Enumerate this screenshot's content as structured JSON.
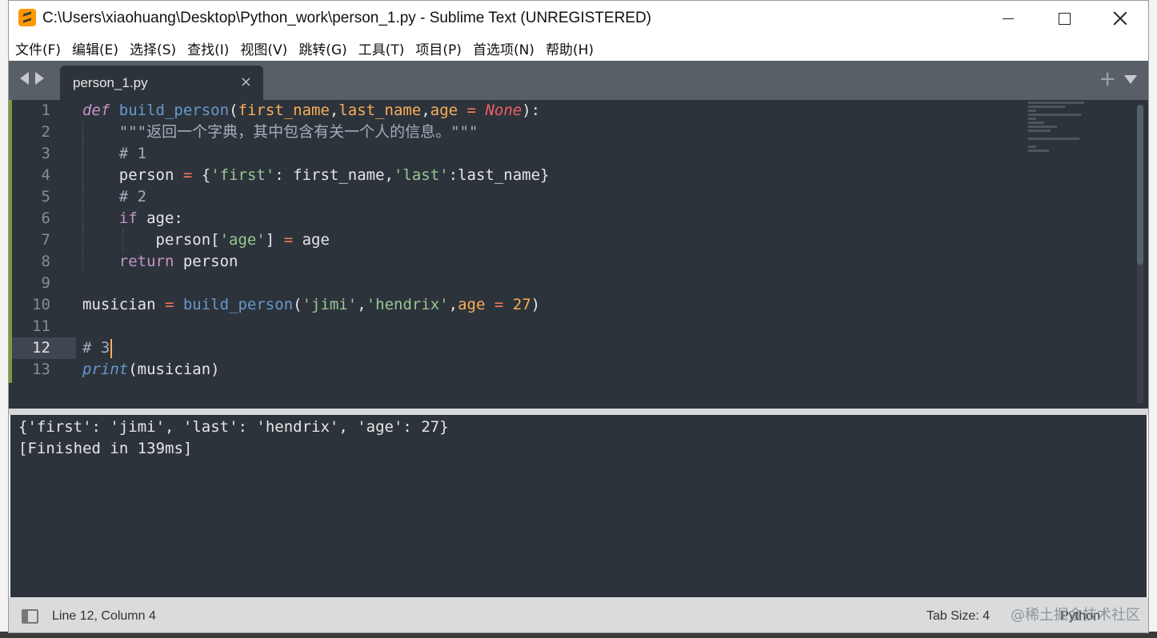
{
  "window": {
    "title": "C:\\Users\\xiaohuang\\Desktop\\Python_work\\person_1.py - Sublime Text (UNREGISTERED)"
  },
  "menu": [
    "文件(F)",
    "编辑(E)",
    "选择(S)",
    "查找(I)",
    "视图(V)",
    "跳转(G)",
    "工具(T)",
    "项目(P)",
    "首选项(N)",
    "帮助(H)"
  ],
  "tab": {
    "label": "person_1.py",
    "close": "×",
    "plus": "+"
  },
  "editor": {
    "line_numbers": [
      "1",
      "2",
      "3",
      "4",
      "5",
      "6",
      "7",
      "8",
      "9",
      "10",
      "11",
      "12",
      "13"
    ],
    "current_line": 12,
    "tokens": {
      "l1": [
        "def",
        " ",
        "build_person",
        "(",
        "first_name",
        ",",
        "last_name",
        ",",
        "age",
        " ",
        "=",
        " ",
        "None",
        "):"
      ],
      "l2": [
        "    \"\"\"返回一个字典，其中包含有关一个人的信息。\"\"\""
      ],
      "l3": [
        "    # 1"
      ],
      "l4": [
        "    person ",
        "=",
        " {",
        "'first'",
        ": first_name,",
        "'last'",
        ":last_name}"
      ],
      "l5": [
        "    # 2"
      ],
      "l6": [
        "    ",
        "if",
        " age:"
      ],
      "l7": [
        "        person[",
        "'age'",
        "] ",
        "=",
        " age"
      ],
      "l8": [
        "    ",
        "return",
        " person"
      ],
      "l10": [
        "musician ",
        "=",
        " ",
        "build_person",
        "(",
        "'jimi'",
        ",",
        "'hendrix'",
        ",",
        "age",
        " ",
        "=",
        " ",
        "27",
        ")"
      ],
      "l12": [
        "# 3"
      ],
      "l13": [
        "print",
        "(musician)"
      ]
    }
  },
  "output": {
    "lines": [
      "{'first': 'jimi', 'last': 'hendrix', 'age': 27}",
      "[Finished in 139ms]"
    ]
  },
  "status": {
    "position": "Line 12, Column 4",
    "tab_size": "Tab Size: 4",
    "syntax": "Python",
    "watermark": "@稀土掘金技术社区"
  }
}
